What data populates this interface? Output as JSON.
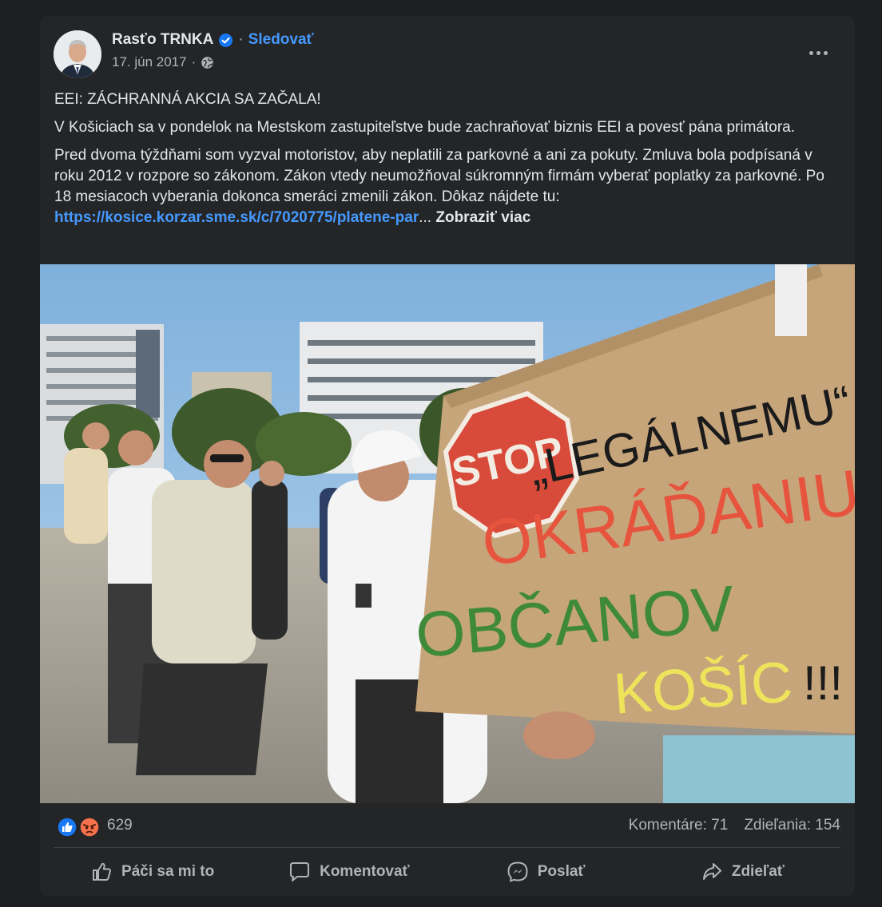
{
  "post": {
    "author": "Rasťo TRNKA",
    "follow_label": "Sledovať",
    "separator": "·",
    "date": "17. jún 2017",
    "paragraph1": "EEI: ZÁCHRANNÁ AKCIA SA ZAČALA!",
    "paragraph2": "V Košiciach sa v pondelok na Mestskom zastupiteľstve bude zachraňovať biznis EEI a povesť pána primátora.",
    "paragraph3": "Pred dvoma týždňami som vyzval motoristov, aby neplatili za parkovné a ani za pokuty. Zmluva bola podpísaná v roku 2012 v rozpore so zákonom. Zákon vtedy neumožňoval súkromným firmám vyberať poplatky za parkovné. Po 18 mesiacoch vyberania dokonca smeráci zmenili zákon. Dôkaz nájdete tu:",
    "link_text": "https://kosice.korzar.sme.sk/c/7020775/platene-par",
    "ellipsis": "...",
    "see_more": "Zobraziť viac"
  },
  "photo": {
    "sign_stop": "STOP",
    "sign_line1": "„LEGÁLNEMU“",
    "sign_line2": "OKRÁĎANIU",
    "sign_line3": "OBČANOV",
    "sign_line4": "KOŠÍC",
    "sign_exclaim": "!!!"
  },
  "stats": {
    "reactions": "629",
    "comments": "Komentáre: 71",
    "shares": "Zdieľania: 154"
  },
  "actions": {
    "like": "Páči sa mi to",
    "comment": "Komentovať",
    "send": "Poslať",
    "share": "Zdieľať"
  },
  "colors": {
    "card_bg": "#242526",
    "link": "#4599ff",
    "muted": "#b0b3b8",
    "like_blue": "#1877f2",
    "angry_orange": "#f7714c"
  },
  "icons": [
    "verified-badge-icon",
    "globe-icon",
    "more-options-icon",
    "like-reaction-icon",
    "angry-reaction-icon",
    "thumbs-up-icon",
    "comment-icon",
    "messenger-icon",
    "share-icon"
  ]
}
